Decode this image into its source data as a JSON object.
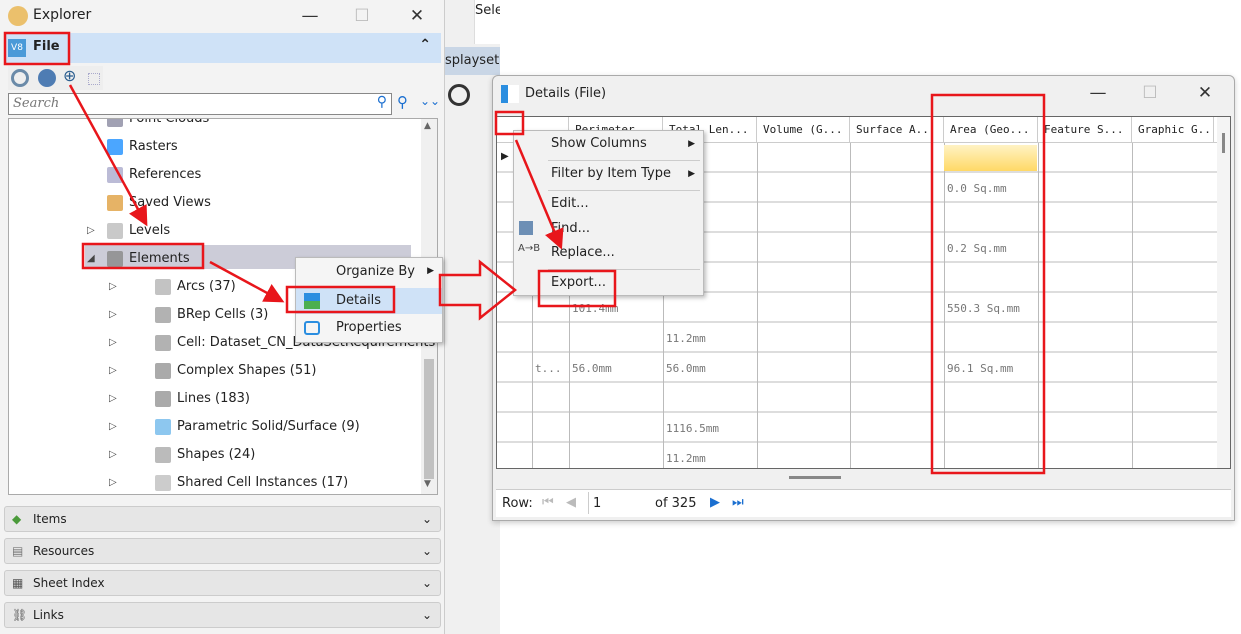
{
  "background": {
    "tab_fragment": "splayset1",
    "toolbar_fragment": "Sele"
  },
  "explorer": {
    "title": "Explorer",
    "file_section": "File",
    "search_placeholder": "Search",
    "tree": [
      {
        "label": "Point Clouds",
        "icon": "point-clouds-icon"
      },
      {
        "label": "Rasters",
        "icon": "rasters-icon"
      },
      {
        "label": "References",
        "icon": "references-icon"
      },
      {
        "label": "Saved Views",
        "icon": "saved-views-icon"
      },
      {
        "label": "Levels",
        "icon": "levels-icon"
      },
      {
        "label": "Elements",
        "icon": "elements-icon"
      },
      {
        "label": "Arcs (37)",
        "icon": "arc-icon"
      },
      {
        "label": "BRep Cells (3)",
        "icon": "brep-cell-icon"
      },
      {
        "label": "Cell: Dataset_CN_DataSetRequirements",
        "icon": "cell-icon"
      },
      {
        "label": "Complex Shapes (51)",
        "icon": "complex-shape-icon"
      },
      {
        "label": "Lines (183)",
        "icon": "line-icon"
      },
      {
        "label": "Parametric Solid/Surface (9)",
        "icon": "solid-icon"
      },
      {
        "label": "Shapes (24)",
        "icon": "shape-icon"
      },
      {
        "label": "Shared Cell Instances (17)",
        "icon": "shared-cell-icon"
      }
    ],
    "sections": [
      "Items",
      "Resources",
      "Sheet Index",
      "Links"
    ]
  },
  "context_menu_1": {
    "items": [
      "Organize By",
      "Details",
      "Properties"
    ],
    "highlighted": "Details"
  },
  "details": {
    "title": "Details (File)",
    "columns": [
      "",
      "Perimeter",
      "Total Len...",
      "Volume (G...",
      "Surface A...",
      "Area (Geo...",
      "Feature S...",
      "Graphic G..."
    ],
    "rows": [
      [
        "",
        "",
        "",
        "",
        "",
        "",
        "",
        ""
      ],
      [
        "",
        "",
        "",
        "",
        "",
        "0.0 Sq.mm",
        "",
        ""
      ],
      [
        "",
        "",
        "",
        "",
        "",
        "",
        "",
        ""
      ],
      [
        "",
        "",
        "",
        "",
        "",
        "0.2 Sq.mm",
        "",
        ""
      ],
      [
        "",
        "",
        "",
        "",
        "",
        "",
        "",
        ""
      ],
      [
        "",
        "101.4mm",
        "",
        "",
        "",
        "550.3 Sq.mm",
        "",
        ""
      ],
      [
        "",
        "",
        "11.2mm",
        "",
        "",
        "",
        "",
        ""
      ],
      [
        "t...",
        "56.0mm",
        "56.0mm",
        "",
        "",
        "96.1 Sq.mm",
        "",
        ""
      ],
      [
        "",
        "",
        "",
        "",
        "",
        "",
        "",
        ""
      ],
      [
        "",
        "",
        "1116.5mm",
        "",
        "",
        "",
        "",
        ""
      ],
      [
        "",
        "",
        "11.2mm",
        "",
        "",
        "",
        "",
        ""
      ]
    ],
    "footer": {
      "row_label": "Row:",
      "row_value": "1",
      "of_label": "of 325"
    }
  },
  "context_menu_2": {
    "items": [
      "Show Columns",
      "Filter by Item Type",
      "Edit...",
      "Find...",
      "Replace...",
      "Export..."
    ]
  },
  "colors": {
    "annotation": "#e8161b",
    "selection": "#cfe2f7",
    "highlight_cell": "#ffd966"
  }
}
